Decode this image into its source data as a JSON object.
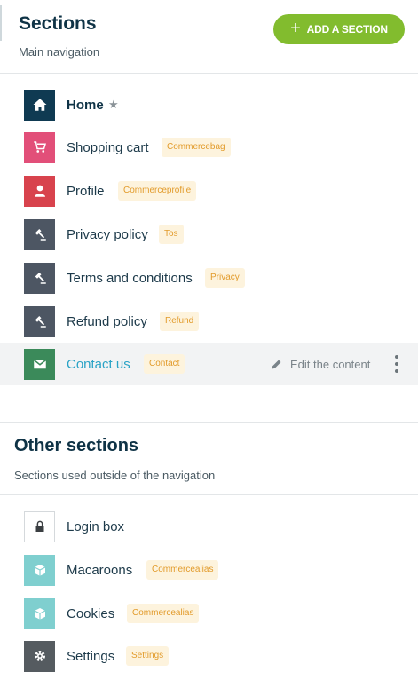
{
  "header": {
    "title": "Sections",
    "subtitle": "Main navigation",
    "add_button": "ADD A SECTION"
  },
  "main_nav": [
    {
      "label": "Home",
      "tag": "",
      "icon": "home-icon",
      "color": "#0f3a52"
    },
    {
      "label": "Shopping cart",
      "tag": "Commercebag",
      "icon": "cart-icon",
      "color": "#e24f79"
    },
    {
      "label": "Profile",
      "tag": "Commerceprofile",
      "icon": "user-icon",
      "color": "#d8434d"
    },
    {
      "label": "Privacy policy",
      "tag": "Tos",
      "icon": "gavel-icon",
      "color": "#4d5663"
    },
    {
      "label": "Terms and conditions",
      "tag": "Privacy",
      "icon": "gavel-icon",
      "color": "#4d5663"
    },
    {
      "label": "Refund policy",
      "tag": "Refund",
      "icon": "gavel-icon",
      "color": "#4d5663"
    },
    {
      "label": "Contact us",
      "tag": "Contact",
      "icon": "envelope-icon",
      "color": "#3b8a5a"
    }
  ],
  "active_row": {
    "edit_label": "Edit the content"
  },
  "other": {
    "title": "Other sections",
    "subtitle": "Sections used outside of the navigation",
    "items": [
      {
        "label": "Login box",
        "tag": "",
        "icon": "lock-icon",
        "color": "#ffffff"
      },
      {
        "label": "Macaroons",
        "tag": "Commercealias",
        "icon": "box-icon",
        "color": "#7fcfcf"
      },
      {
        "label": "Cookies",
        "tag": "Commercealias",
        "icon": "box-icon",
        "color": "#7fcfcf"
      },
      {
        "label": "Settings",
        "tag": "Settings",
        "icon": "gear-icon",
        "color": "#555b60"
      }
    ]
  }
}
